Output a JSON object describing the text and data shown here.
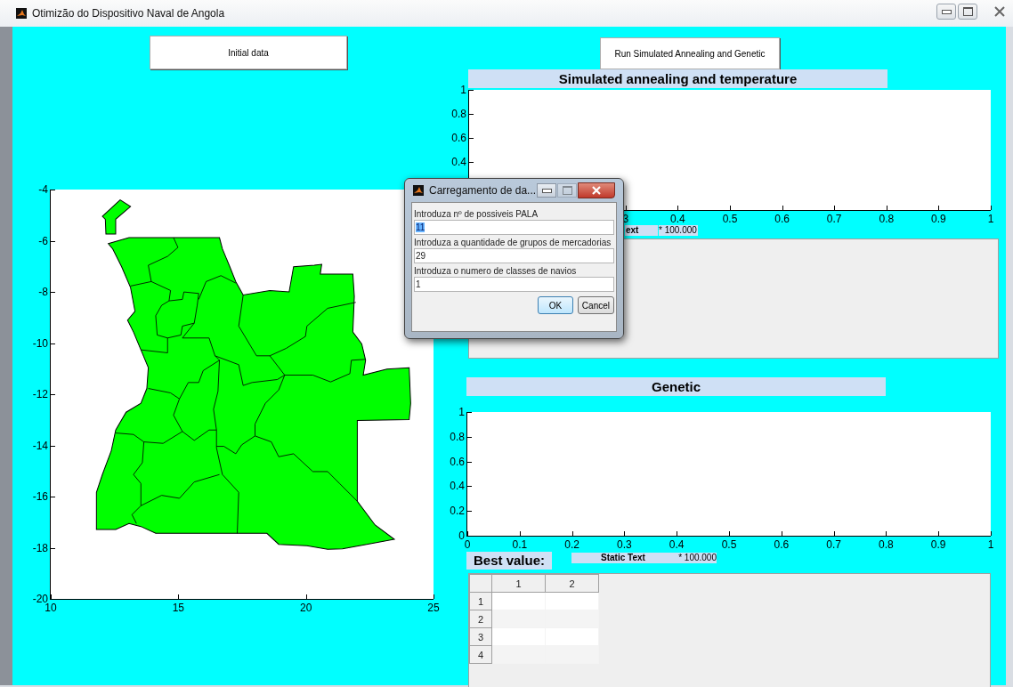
{
  "window": {
    "title": "Otimizão do Dispositivo Naval de Angola"
  },
  "buttons": [
    {
      "label": "Initial data"
    },
    {
      "label": "Run Simulated Annealing and Genetic"
    }
  ],
  "map_axes": {
    "xticks": [
      "10",
      "15",
      "20",
      "25"
    ],
    "yticks": [
      "-4",
      "-6",
      "-8",
      "-10",
      "-12",
      "-14",
      "-16",
      "-18",
      "-20"
    ]
  },
  "annealing": {
    "title": "Simulated annealing and temperature",
    "yticks": [
      "1",
      "0.8",
      "0.6",
      "0.4"
    ],
    "xticks": [
      "3",
      "0.4",
      "0.5",
      "0.6",
      "0.7",
      "0.8",
      "0.9",
      "1"
    ],
    "static_text": "ext",
    "multiplier": "* 100.000"
  },
  "genetic": {
    "title": "Genetic",
    "yticks": [
      "1",
      "0.8",
      "0.6",
      "0.4",
      "0.2",
      "0"
    ],
    "xticks": [
      "0",
      "0.1",
      "0.2",
      "0.3",
      "0.4",
      "0.5",
      "0.6",
      "0.7",
      "0.8",
      "0.9",
      "1"
    ]
  },
  "best_value": {
    "label": "Best value:",
    "static_text": "Static Text",
    "multiplier": "* 100.000"
  },
  "table": {
    "columns": [
      "1",
      "2"
    ],
    "rows": [
      "1",
      "2",
      "3",
      "4"
    ]
  },
  "dialog": {
    "title": "Carregamento de da...",
    "fields": [
      {
        "label": "Introduza nº de possiveis PALA",
        "value": "11",
        "selected": true
      },
      {
        "label": "Introduza a quantidade de grupos de mercadorias",
        "value": "29",
        "selected": false
      },
      {
        "label": "Introduza o numero de classes de navios",
        "value": "1",
        "selected": false
      }
    ],
    "buttons": [
      "OK",
      "Cancel"
    ]
  }
}
